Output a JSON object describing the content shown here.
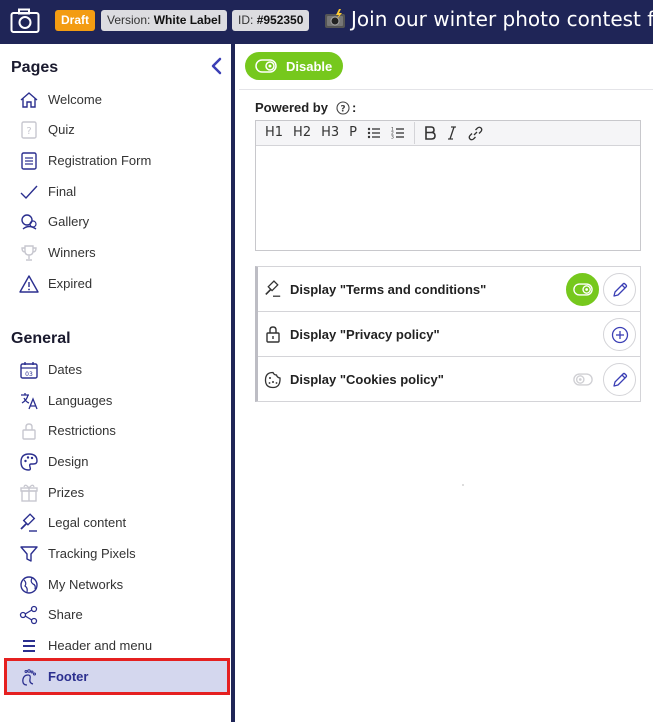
{
  "topbar": {
    "status_badge": "Draft",
    "version_label": "Version:",
    "version_value": "White Label",
    "id_label": "ID:",
    "id_value": "#952350",
    "contest_text": "Join our winter photo contest fo"
  },
  "sidebar": {
    "pages_title": "Pages",
    "pages": [
      {
        "label": "Welcome",
        "icon": "home-icon"
      },
      {
        "label": "Quiz",
        "icon": "quiz-icon"
      },
      {
        "label": "Registration Form",
        "icon": "form-icon"
      },
      {
        "label": "Final",
        "icon": "check-icon"
      },
      {
        "label": "Gallery",
        "icon": "gallery-icon"
      },
      {
        "label": "Winners",
        "icon": "trophy-icon"
      },
      {
        "label": "Expired",
        "icon": "warning-icon"
      }
    ],
    "general_title": "General",
    "general": [
      {
        "label": "Dates",
        "icon": "calendar-icon"
      },
      {
        "label": "Languages",
        "icon": "translate-icon"
      },
      {
        "label": "Restrictions",
        "icon": "lock-icon"
      },
      {
        "label": "Design",
        "icon": "palette-icon"
      },
      {
        "label": "Prizes",
        "icon": "gift-icon"
      },
      {
        "label": "Legal content",
        "icon": "gavel-icon"
      },
      {
        "label": "Tracking Pixels",
        "icon": "filter-icon"
      },
      {
        "label": "My Networks",
        "icon": "globe-icon"
      },
      {
        "label": "Share",
        "icon": "share-icon"
      },
      {
        "label": "Header and menu",
        "icon": "menu-icon"
      },
      {
        "label": "Footer",
        "icon": "foot-icon",
        "active": true
      }
    ]
  },
  "main": {
    "disable_label": "Disable",
    "powered_by_label": "Powered by",
    "powered_by_colon": ":",
    "editor_toolbar": [
      "H1",
      "H2",
      "H3",
      "P"
    ],
    "editor_value": "",
    "options": [
      {
        "label": "Display \"Terms and conditions\"",
        "icon": "gavel-icon",
        "toggle": "on",
        "action": "edit"
      },
      {
        "label": "Display \"Privacy policy\"",
        "icon": "lock-icon",
        "toggle": "none",
        "action": "add"
      },
      {
        "label": "Display \"Cookies policy\"",
        "icon": "cookie-icon",
        "toggle": "off",
        "action": "edit"
      }
    ]
  },
  "colors": {
    "navy": "#1f2557",
    "green": "#76c81d",
    "orange": "#f39c12",
    "accent": "#3b3fb5",
    "active_bg": "#d4d7ee",
    "highlight": "#e52020"
  }
}
